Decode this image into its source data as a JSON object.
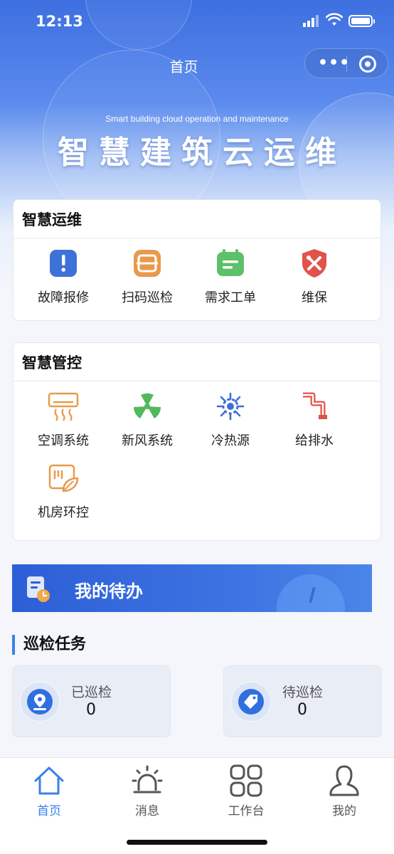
{
  "status_bar": {
    "time": "12:13"
  },
  "nav": {
    "title": "首页"
  },
  "hero": {
    "subtitle": "Smart building cloud operation and maintenance",
    "title": "智慧建筑云运维"
  },
  "ops_card": {
    "title": "智慧运维",
    "items": [
      {
        "label": "故障报修",
        "icon": "alert-icon",
        "color": "#3d72d8"
      },
      {
        "label": "扫码巡检",
        "icon": "scan-icon",
        "color": "#e89a4c"
      },
      {
        "label": "需求工单",
        "icon": "ticket-icon",
        "color": "#5dc06a"
      },
      {
        "label": "维保",
        "icon": "wrench-shield-icon",
        "color": "#e0534a"
      }
    ]
  },
  "control_card": {
    "title": "智慧管控",
    "items": [
      {
        "label": "空调系统",
        "icon": "air-conditioner-icon",
        "color": "#e89a4c"
      },
      {
        "label": "新风系统",
        "icon": "fan-icon",
        "color": "#52b85c"
      },
      {
        "label": "冷热源",
        "icon": "snow-sun-icon",
        "color": "#3d6fd8"
      },
      {
        "label": "给排水",
        "icon": "pipe-icon",
        "color": "#e0534a"
      },
      {
        "label": "机房环控",
        "icon": "server-room-icon",
        "color": "#e89a4c"
      }
    ]
  },
  "todo_banner": {
    "label": "我的待办"
  },
  "inspection": {
    "title": "巡检任务",
    "done": {
      "label": "已巡检",
      "value": "0"
    },
    "pending": {
      "label": "待巡检",
      "value": "0"
    }
  },
  "tabbar": {
    "items": [
      {
        "label": "首页",
        "icon": "home-icon",
        "active": true
      },
      {
        "label": "消息",
        "icon": "alarm-icon",
        "active": false
      },
      {
        "label": "工作台",
        "icon": "grid-icon",
        "active": false
      },
      {
        "label": "我的",
        "icon": "user-icon",
        "active": false
      }
    ],
    "active_color": "#3b82e6"
  }
}
